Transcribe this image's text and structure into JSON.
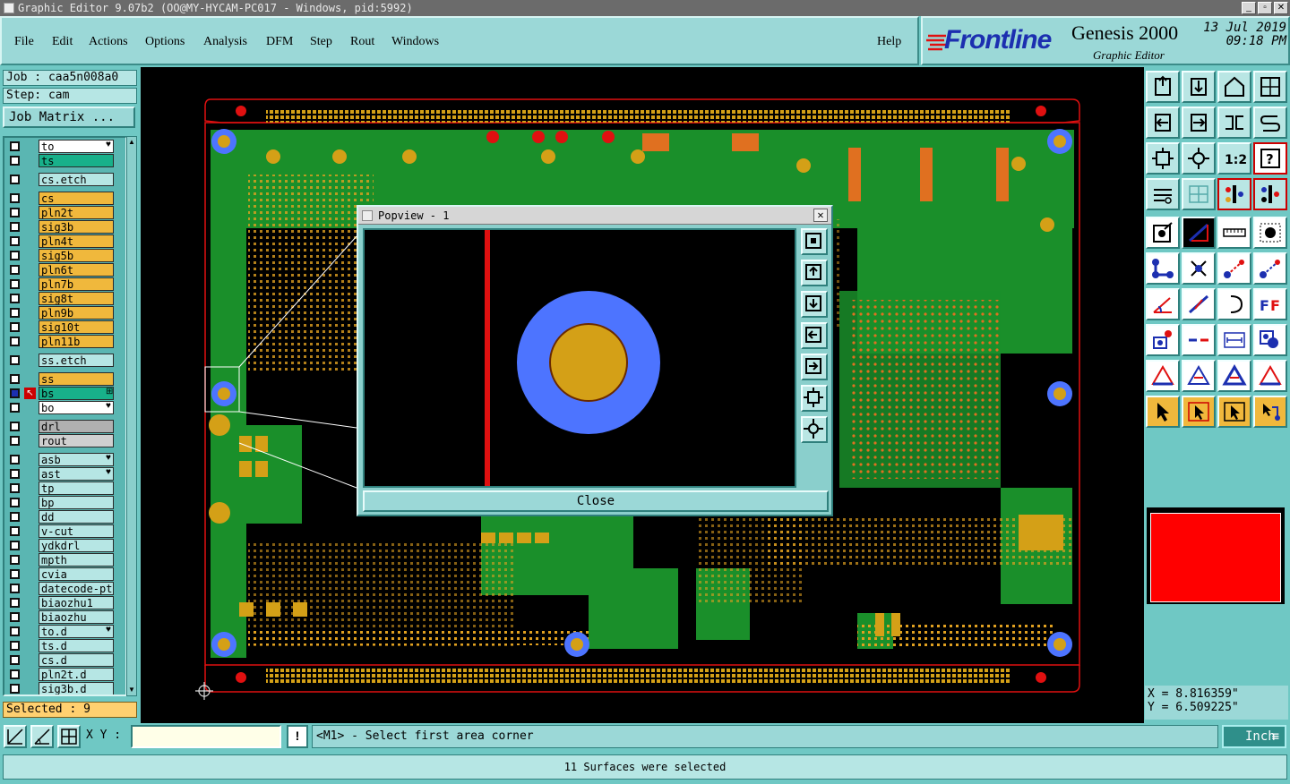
{
  "window": {
    "title": "Graphic Editor 9.07b2 (OO@MY-HYCAM-PC017 - Windows, pid:5992)"
  },
  "menu": {
    "items": [
      "File",
      "Edit",
      "Actions",
      "Options",
      "Analysis",
      "DFM",
      "Step",
      "Rout",
      "Windows"
    ],
    "help": "Help"
  },
  "brand": {
    "logo": "Frontline",
    "product": "Genesis 2000",
    "module": "Graphic Editor",
    "date": "13 Jul 2019",
    "time": "09:18 PM"
  },
  "job": {
    "job": "Job : caa5n008a0",
    "step": "Step: cam",
    "matrix_button": "Job Matrix ..."
  },
  "layers": [
    {
      "name": "to",
      "color": "#ffffff",
      "mark": "♥"
    },
    {
      "name": "ts",
      "color": "#18b08a"
    },
    {
      "name": "cs.etch",
      "color": "#b6e6e4"
    },
    {
      "name": "cs",
      "color": "#f0b83c"
    },
    {
      "name": "pln2t",
      "color": "#f0b83c"
    },
    {
      "name": "sig3b",
      "color": "#f0b83c"
    },
    {
      "name": "pln4t",
      "color": "#f0b83c"
    },
    {
      "name": "sig5b",
      "color": "#f0b83c"
    },
    {
      "name": "pln6t",
      "color": "#f0b83c"
    },
    {
      "name": "pln7b",
      "color": "#f0b83c"
    },
    {
      "name": "sig8t",
      "color": "#f0b83c"
    },
    {
      "name": "pln9b",
      "color": "#f0b83c"
    },
    {
      "name": "sig10t",
      "color": "#f0b83c"
    },
    {
      "name": "pln11b",
      "color": "#f0b83c"
    },
    {
      "name": "ss.etch",
      "color": "#b6e6e4"
    },
    {
      "name": "ss",
      "color": "#f0b83c"
    },
    {
      "name": "bs",
      "color": "#18b08a",
      "active": true,
      "mark": "⊞"
    },
    {
      "name": "bo",
      "color": "#ffffff",
      "mark": "♥"
    },
    {
      "name": "drl",
      "color": "#b0b0b0"
    },
    {
      "name": "rout",
      "color": "#d0d0d0"
    },
    {
      "name": "asb",
      "color": "#b6e6e4",
      "mark": "♥"
    },
    {
      "name": "ast",
      "color": "#b6e6e4",
      "mark": "♥"
    },
    {
      "name": "tp",
      "color": "#b6e6e4"
    },
    {
      "name": "bp",
      "color": "#b6e6e4"
    },
    {
      "name": "dd",
      "color": "#b6e6e4"
    },
    {
      "name": "v-cut",
      "color": "#b6e6e4"
    },
    {
      "name": "ydkdrl",
      "color": "#b6e6e4"
    },
    {
      "name": "mpth",
      "color": "#b6e6e4"
    },
    {
      "name": "cvia",
      "color": "#b6e6e4"
    },
    {
      "name": "datecode-pto",
      "color": "#b6e6e4"
    },
    {
      "name": "biaozhu1",
      "color": "#b6e6e4"
    },
    {
      "name": "biaozhu",
      "color": "#b6e6e4"
    },
    {
      "name": "to.d",
      "color": "#b6e6e4",
      "mark": "♥"
    },
    {
      "name": "ts.d",
      "color": "#b6e6e4"
    },
    {
      "name": "cs.d",
      "color": "#b6e6e4"
    },
    {
      "name": "pln2t.d",
      "color": "#b6e6e4"
    },
    {
      "name": "sig3b.d",
      "color": "#b6e6e4"
    }
  ],
  "selected_text": "Selected : 9",
  "popup": {
    "title": "Popview - 1",
    "close_label": "Close"
  },
  "coords": {
    "x": "X = 8.816359\"",
    "y": "Y = 6.509225\""
  },
  "command": {
    "xy_label": "X Y :",
    "xy_value": "",
    "prompt": "<M1> - Select first area corner",
    "unit": "Inch"
  },
  "status": "11 Surfaces were selected",
  "colors": {
    "board": "#1a8f2a",
    "pad": "#d4a017",
    "ring": "#4d74ff",
    "outline": "#e01010",
    "panel": "#6fc8c4"
  }
}
